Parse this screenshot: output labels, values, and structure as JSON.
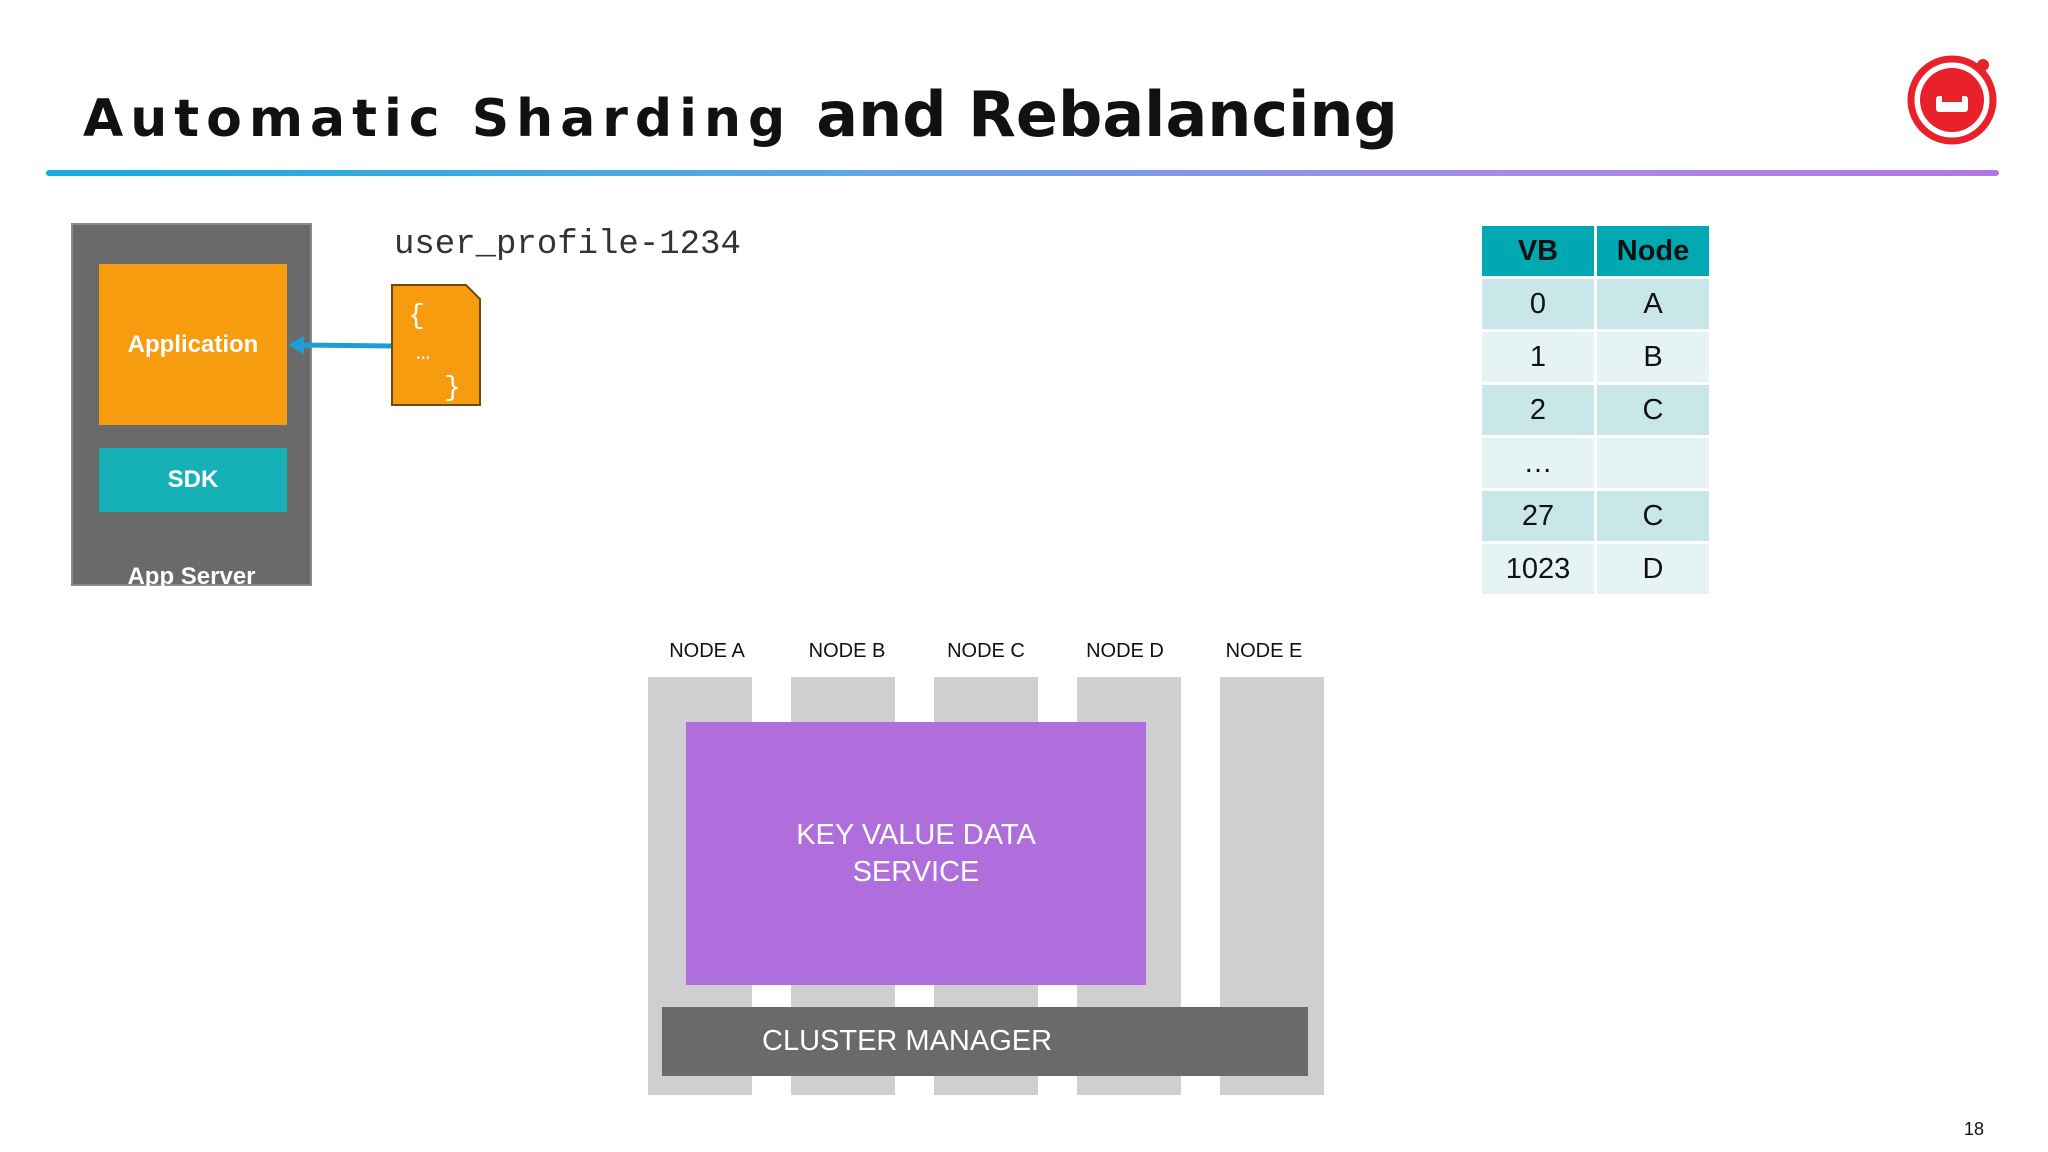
{
  "title": {
    "part1": "Automatic Sharding",
    "part2": "and Rebalancing"
  },
  "colors": {
    "application": "#f79c0f",
    "sdk": "#15b1b7",
    "app_server": "#6a6a6a",
    "kv_service": "#b06ddc",
    "cluster_manager": "#6a6a6a",
    "node_column": "#cfcfd1",
    "table_header": "#00a9b2",
    "logo": "#e8212a"
  },
  "app_server": {
    "label": "App Server",
    "application": "Application",
    "sdk": "SDK"
  },
  "document": {
    "key": "user_profile-1234",
    "line1": "{",
    "line2": "…",
    "line3": "}"
  },
  "vb_table": {
    "headers": [
      "VB",
      "Node"
    ],
    "rows": [
      [
        "0",
        "A"
      ],
      [
        "1",
        "B"
      ],
      [
        "2",
        "C"
      ],
      [
        "…",
        ""
      ],
      [
        "27",
        "C"
      ],
      [
        "1023",
        "D"
      ]
    ]
  },
  "cluster": {
    "nodes": [
      "NODE A",
      "NODE B",
      "NODE C",
      "NODE D",
      "NODE E"
    ],
    "kv_service": "KEY VALUE DATA SERVICE",
    "cluster_manager": "CLUSTER MANAGER"
  },
  "page_number": "18",
  "icons": {
    "logo": "couchbase-logo-icon",
    "arrow": "arrow-left-icon",
    "document": "json-document-icon"
  }
}
